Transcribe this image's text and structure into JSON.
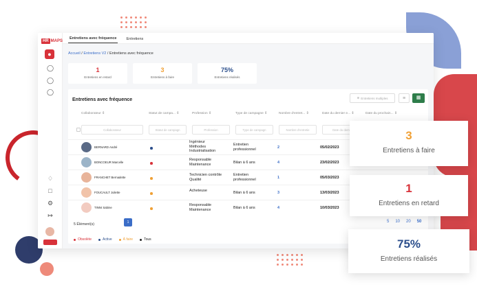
{
  "logo": {
    "mark": "HR",
    "text": "MAPS"
  },
  "tabs": [
    "Entretiens avec fréquence",
    "Entretiens"
  ],
  "breadcrumb": {
    "home": "Accueil",
    "parent": "Entretiens V2",
    "current": "Entretiens avec fréquence"
  },
  "stats": [
    {
      "value": "1",
      "label": "Entretiens en retard",
      "color": "#d8323a"
    },
    {
      "value": "3",
      "label": "Entretiens à faire",
      "color": "#f0a035"
    },
    {
      "value": "75%",
      "label": "Entretiens réalisés",
      "color": "#2c4f8c"
    }
  ],
  "panel": {
    "title": "Entretiens avec fréquence",
    "multi_label": "Entretiens multiples",
    "columns": [
      "Collaborateur ⇕",
      "Statut de campa... ⇕",
      "Profession ⇕",
      "Type de campagne ⇕",
      "Nombre d'entret... ⇕",
      "Date du dernier e... ⇕",
      "Date du prochain... ⇕"
    ],
    "filters": [
      "Collaborateur",
      "Statut de campagn",
      "Profession",
      "Type de campagn",
      "Nombre d'entretie",
      "Date du dern"
    ],
    "rows": [
      {
        "name": "BERNARD André",
        "status_color": "#2c4f8c",
        "profession": [
          "Ingénieur",
          "Méthodes",
          "Industrialisation"
        ],
        "type": [
          "Entretien",
          "professionnel"
        ],
        "count": "2",
        "date": "05/02/2023"
      },
      {
        "name": "BONCOEUR Marcelle",
        "status_color": "#d8323a",
        "profession": [
          "Responsable",
          "Maintenance"
        ],
        "type": [
          "Bilan à 6 ans"
        ],
        "count": "4",
        "date": "23/02/2023"
      },
      {
        "name": "FRANCHET Bernadette",
        "status_color": "#f0a035",
        "profession": [
          "Technicien contrôle",
          "Qualité"
        ],
        "type": [
          "Entretien",
          "professionnel"
        ],
        "count": "1",
        "date": "05/03/2023"
      },
      {
        "name": "FOUCAULT Juliette",
        "status_color": "#f0a035",
        "profession": [
          "Acheteuse"
        ],
        "type": [
          "Bilan à 6 ans"
        ],
        "count": "3",
        "date": "13/03/2023"
      },
      {
        "name": "TINNI Sabine",
        "status_color": "#f0a035",
        "profession": [
          "Responsable",
          "Maintenance"
        ],
        "type": [
          "Bilan à 6 ans"
        ],
        "count": "4",
        "date": "10/03/2023"
      }
    ],
    "count_label": "5 Élément(s)",
    "page": "1",
    "legend": [
      {
        "label": "Obsolète",
        "color": "#d8323a"
      },
      {
        "label": "Active",
        "color": "#2c4f8c"
      },
      {
        "label": "À faire",
        "color": "#f0a035"
      },
      {
        "label": "Tous",
        "color": "#222222"
      }
    ]
  },
  "page_sizes": [
    "5",
    "10",
    "20",
    "50"
  ],
  "cards": [
    {
      "value": "3",
      "label": "Entretiens à faire",
      "color": "#f0a035"
    },
    {
      "value": "1",
      "label": "Entretiens en retard",
      "color": "#d8323a"
    },
    {
      "value": "75%",
      "label": "Entretiens réalisés",
      "color": "#2c4f8c"
    }
  ]
}
